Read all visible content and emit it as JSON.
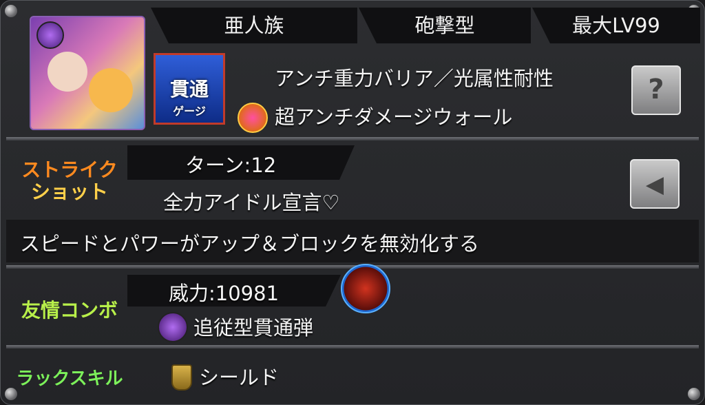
{
  "tags": {
    "race": "亜人族",
    "type": "砲撃型",
    "maxlv": "最大LV99"
  },
  "gauge": {
    "line1": "貫通",
    "line2": "ゲージ"
  },
  "abilities": {
    "main": "アンチ重力バリア／光属性耐性",
    "gauge_ability": "超アンチダメージウォール"
  },
  "strike_shot": {
    "label_line1": "ストライク",
    "label_line2": "ショット",
    "turn": "ターン:12",
    "name": "全力アイドル宣言♡",
    "description": "スピードとパワーがアップ＆ブロックを無効化する"
  },
  "friendship_combo": {
    "label": "友情コンボ",
    "power": "威力:10981",
    "name": "追従型貫通弾"
  },
  "luck_skill": {
    "label": "ラックスキル",
    "name": "シールド"
  },
  "colors": {
    "strike_label": "#ff8a1f",
    "friendship_label": "#b8f04a",
    "luck_label": "#7cf05a",
    "gauge_frame": "#c23b2a"
  }
}
